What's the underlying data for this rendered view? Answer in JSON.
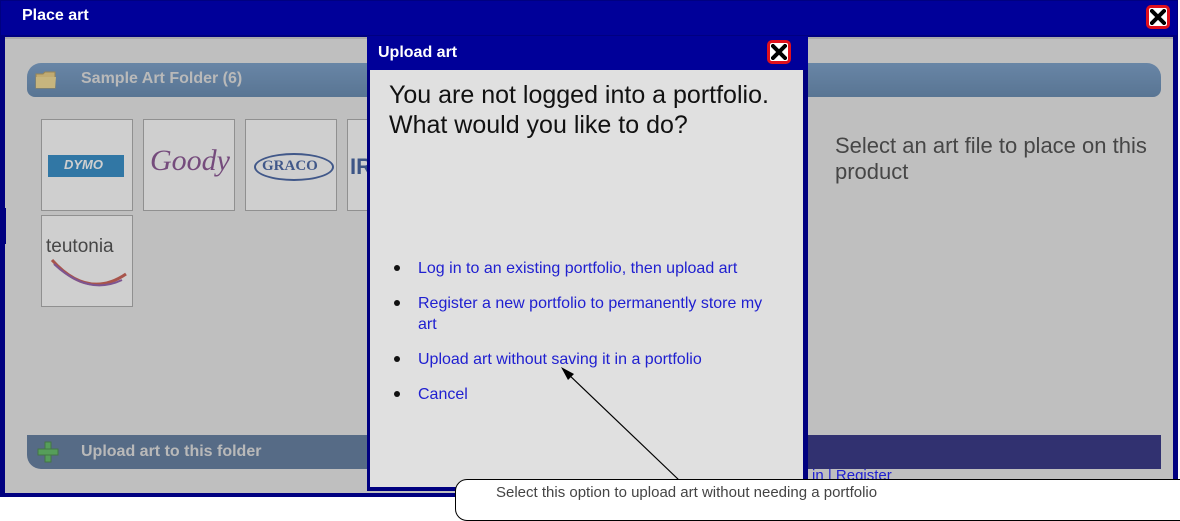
{
  "main_window": {
    "title": "Place art"
  },
  "folder": {
    "label": "Sample Art Folder (6)"
  },
  "art_items": [
    {
      "name": "DYMO",
      "color": "#0072bc"
    },
    {
      "name": "Goody",
      "color": "#6e2b7a"
    },
    {
      "name": "GRACO",
      "color": "#1a3f8f"
    },
    {
      "name": "IR",
      "color": "#123a8a"
    },
    {
      "name": "teutonia",
      "color": "#222222"
    }
  ],
  "placeholder": {
    "text": "Select an art file to place on this product"
  },
  "upload_bar": {
    "label": "Upload art to this folder"
  },
  "upload_dialog": {
    "title": "Upload art",
    "heading": "You are not logged into a portfolio. What would you like to do?",
    "options": [
      {
        "label": "Log in to an existing portfolio, then upload art"
      },
      {
        "label": "Register a new portfolio to permanently store my art"
      },
      {
        "label": "Upload art without saving it in a portfolio"
      },
      {
        "label": "Cancel"
      }
    ]
  },
  "behind_link": {
    "text": "in | Register"
  },
  "callout": {
    "text": "Select this option to upload art without needing a portfolio"
  },
  "colors": {
    "titlebar": "#000099",
    "close_border": "#e0101c",
    "link": "#2020d0",
    "folder_bar": "#4a78aa"
  }
}
